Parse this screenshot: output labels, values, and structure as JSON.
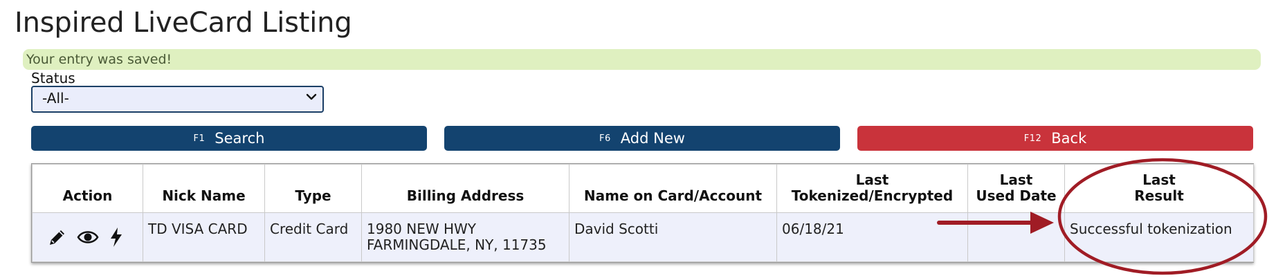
{
  "page": {
    "title": "Inspired LiveCard Listing"
  },
  "alert": {
    "message": "Your entry was saved!"
  },
  "filter": {
    "status_label": "Status",
    "status_value": "-All-"
  },
  "buttons": {
    "search": {
      "key": "F1",
      "label": "Search"
    },
    "add_new": {
      "key": "F6",
      "label": "Add New"
    },
    "back": {
      "key": "F12",
      "label": "Back"
    }
  },
  "table": {
    "headers": {
      "action": "Action",
      "nick_name": "Nick Name",
      "type": "Type",
      "billing_address": "Billing Address",
      "name_on_card": "Name on Card/Account",
      "last_tokenized_1": "Last",
      "last_tokenized_2": "Tokenized/Encrypted",
      "last_used_1": "Last",
      "last_used_2": "Used Date",
      "last_result_1": "Last",
      "last_result_2": "Result"
    },
    "rows": [
      {
        "actions": [
          "pencil-icon",
          "eye-icon",
          "lightning-icon"
        ],
        "nick_name": "TD VISA CARD",
        "type": "Credit Card",
        "billing_address_line1": "1980 NEW HWY",
        "billing_address_line2": "FARMINGDALE, NY, 11735",
        "name_on_card": "David Scotti",
        "last_tokenized": "06/18/21",
        "last_used": "",
        "last_result": "Successful tokenization"
      }
    ]
  },
  "colors": {
    "primary_button": "#13436f",
    "back_button": "#c9333b",
    "alert_background": "#dff0c0",
    "row_background": "#eef0fb",
    "annotation": "#a01c25"
  }
}
